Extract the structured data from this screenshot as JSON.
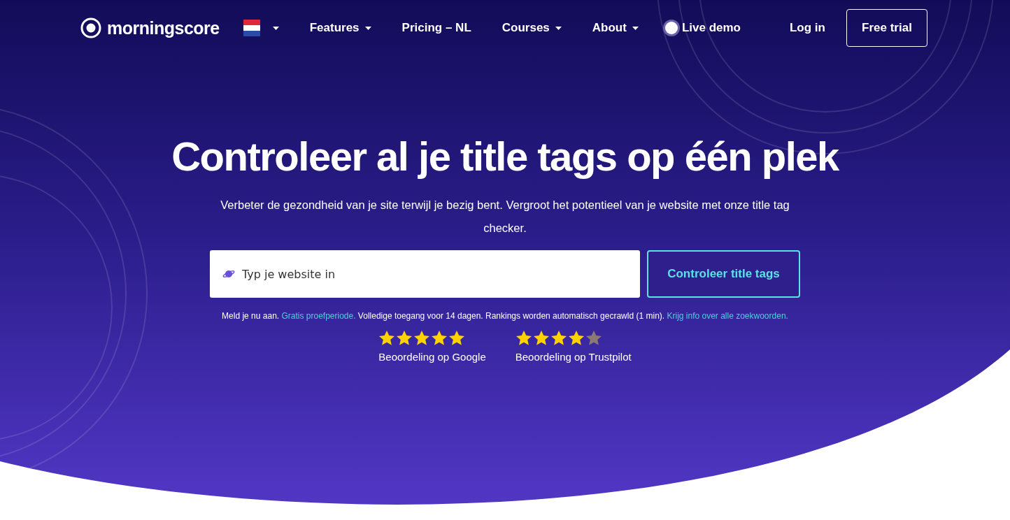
{
  "nav": {
    "logo": "morningscore",
    "items": [
      {
        "label": "Features",
        "dropdown": true
      },
      {
        "label": "Pricing – NL",
        "dropdown": false
      },
      {
        "label": "Courses",
        "dropdown": true
      },
      {
        "label": "About",
        "dropdown": true
      }
    ],
    "live_demo": "Live demo",
    "login": "Log in",
    "cta": "Free trial"
  },
  "hero": {
    "title": "Controleer al je title tags op één plek",
    "subtitle": "Verbeter de gezondheid van je site terwijl je bezig bent. Vergroot het potentieel van je website met onze title tag checker.",
    "search": {
      "placeholder": "Typ je website in"
    },
    "button": "Controleer title tags",
    "note": [
      {
        "kind": "text",
        "text": "Meld je nu aan. "
      },
      {
        "kind": "link",
        "text": "Gratis proefperiode."
      },
      {
        "kind": "text",
        "text": " Volledige toegang voor 14 dagen. Rankings worden automatisch gecrawld (1 min). "
      },
      {
        "kind": "link",
        "text": "Krijg info over alle zoekwoorden."
      }
    ],
    "ratings": [
      {
        "stars": 5,
        "label": "Beoordeling op Google"
      },
      {
        "stars": 4,
        "label": "Beoordeling op Trustpilot"
      }
    ]
  }
}
